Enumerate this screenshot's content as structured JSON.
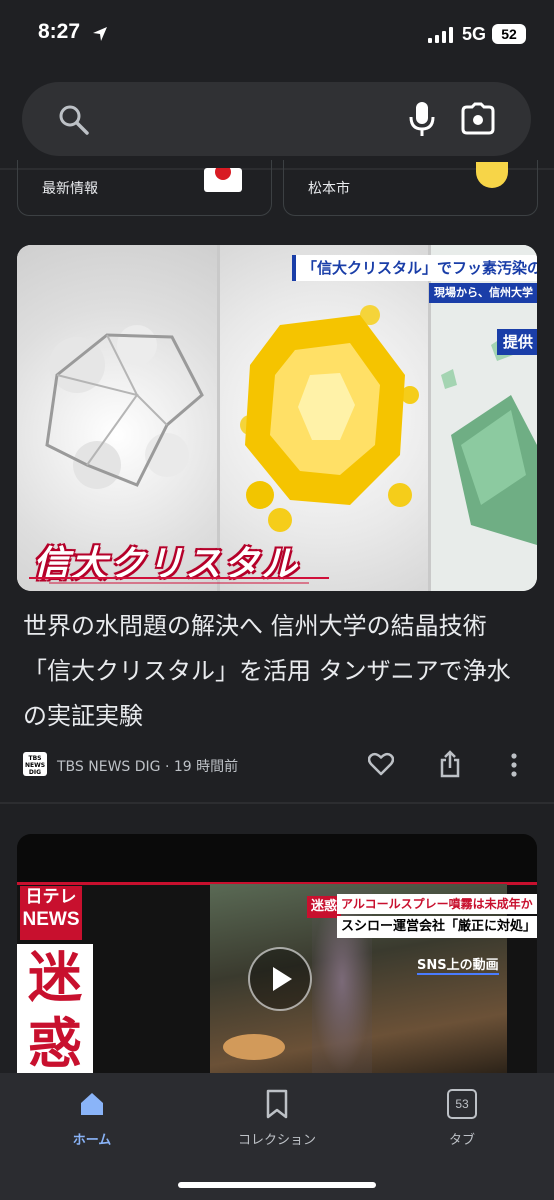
{
  "status_bar": {
    "time": "8:27",
    "network": "5G",
    "battery": "52"
  },
  "search": {
    "placeholder": ""
  },
  "chips": [
    {
      "label": "最新情報"
    },
    {
      "label": "松本市"
    }
  ],
  "article": {
    "image": {
      "caption_main": "「信大クリスタル」でフッ素汚染の",
      "caption_sub": "現場から、信州大学",
      "caption_badge": "提供",
      "banner": "信大クリスタル"
    },
    "headline": "世界の水問題の解決へ 信州大学の結晶技術「信大クリスタル」を活用 タンザニアで浄水の実証実験",
    "source_logo": "TBS NEWS DIG",
    "source": "TBS NEWS DIG",
    "time_ago": "19 時間前"
  },
  "video": {
    "logo_line1": "日テレ",
    "logo_line2": "NEWS",
    "big_text": "迷惑",
    "tag": "迷惑",
    "caption1": "アルコールスプレー噴霧は未成年か",
    "caption2": "スシロー運営会社「厳正に対処」",
    "caption3": "SNS上の動画"
  },
  "bottom_nav": {
    "home": "ホーム",
    "collections": "コレクション",
    "tabs": "タブ",
    "tab_count": "53"
  },
  "colors": {
    "accent": "#8ab4f8",
    "background": "#1f2023",
    "nav_bg": "#2b2c30"
  }
}
